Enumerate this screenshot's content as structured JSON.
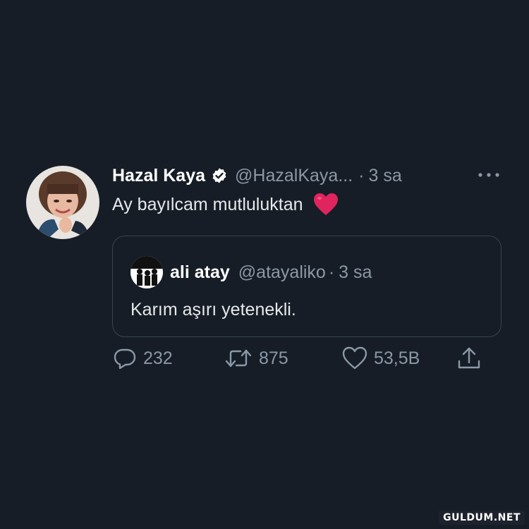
{
  "tweet": {
    "display_name": "Hazal Kaya",
    "handle": "@HazalKaya...",
    "separator": "·",
    "time": "3 sa",
    "text": "Ay bayılcam mutluluktan",
    "emoji_icon": "red-heart-emoji",
    "verified_icon": "verified-badge-icon",
    "more_icon": "more-options-icon"
  },
  "quote": {
    "display_name": "ali atay",
    "handle": "@atayaliko",
    "separator": "·",
    "time": "3 sa",
    "text": "Karım aşırı yetenekli."
  },
  "actions": {
    "reply": {
      "icon": "reply-icon",
      "count": "232"
    },
    "retweet": {
      "icon": "retweet-icon",
      "count": "875"
    },
    "like": {
      "icon": "like-icon",
      "count": "53,5B"
    },
    "share": {
      "icon": "share-icon"
    }
  },
  "watermark": {
    "text": "GULDUM.NET"
  },
  "colors": {
    "background": "#161d27",
    "text_primary": "#e7e9ea",
    "text_secondary": "#8b98a5",
    "border": "#38444d",
    "heart": "#e0245e"
  }
}
